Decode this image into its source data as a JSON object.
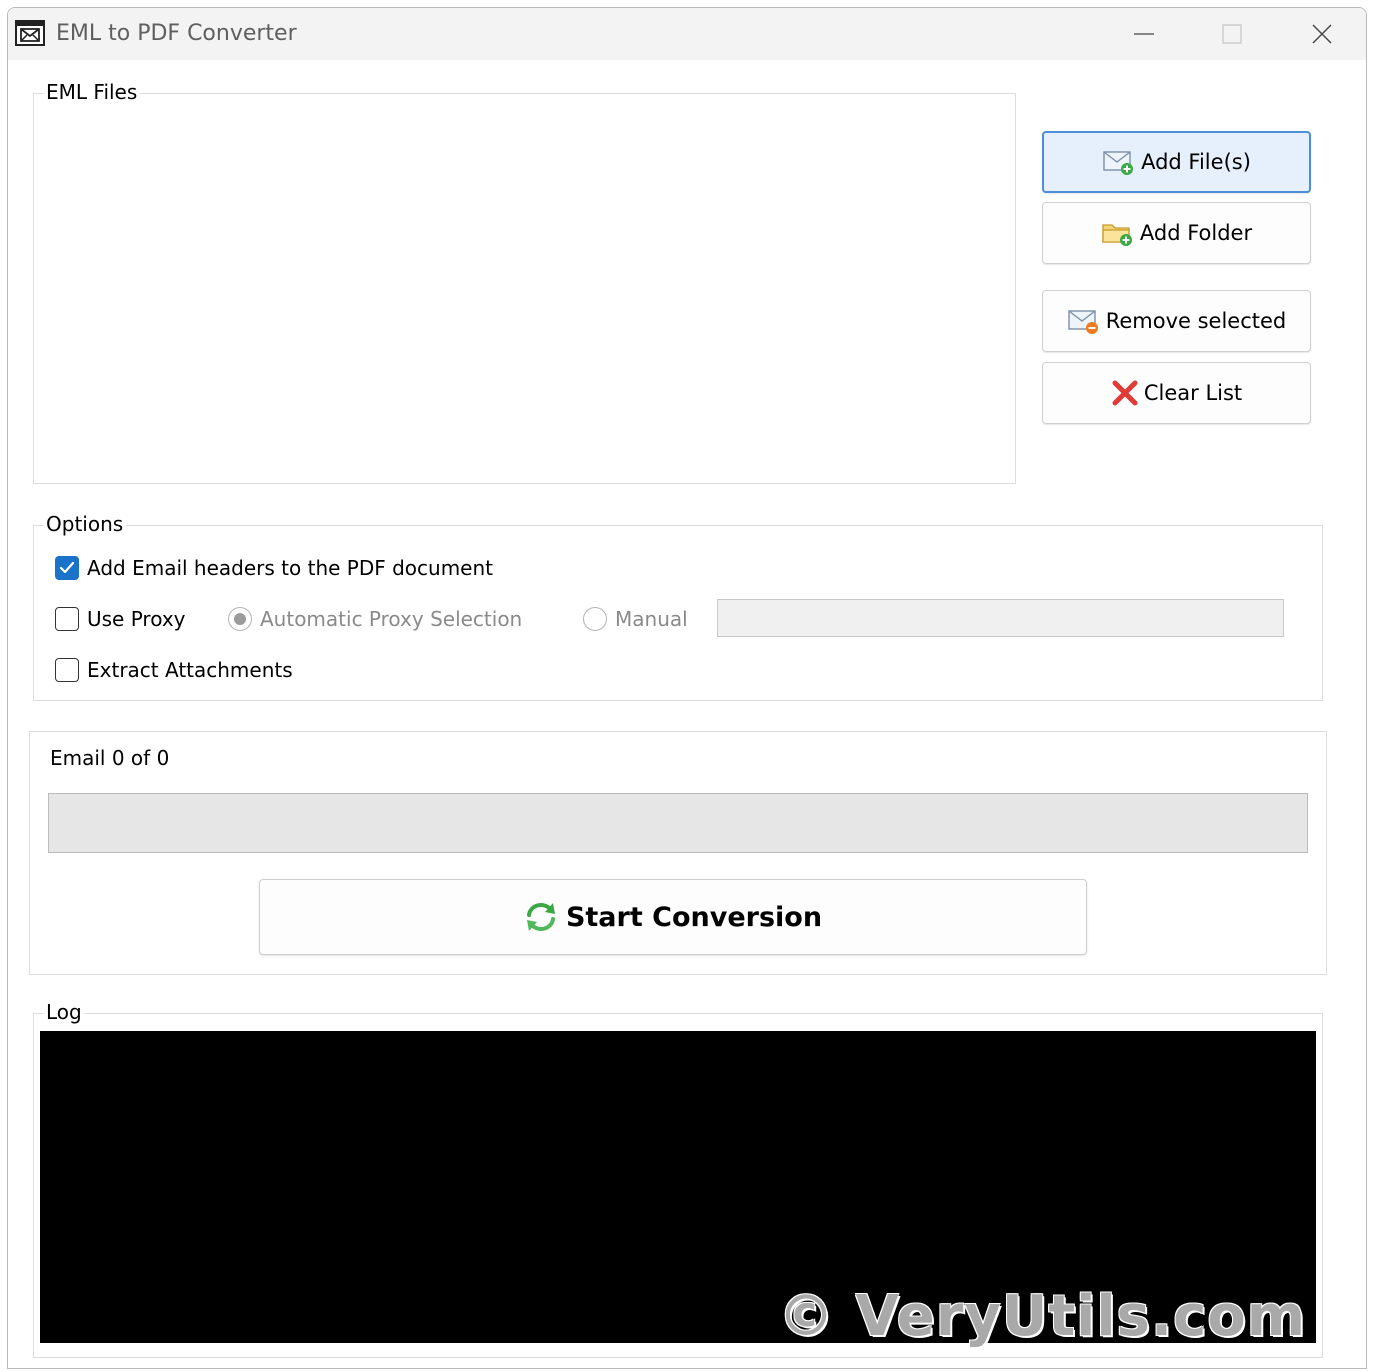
{
  "window": {
    "title": "EML to PDF Converter"
  },
  "icons": {
    "app": "email-window-icon",
    "add_files": "envelope-add-icon",
    "add_folder": "folder-add-icon",
    "remove": "envelope-remove-icon",
    "clear": "red-x-icon",
    "start": "refresh-arrows-icon"
  },
  "files_group": {
    "legend": "EML Files",
    "items": []
  },
  "buttons": {
    "add_files": "Add File(s)",
    "add_folder": "Add Folder",
    "remove_selected": "Remove selected",
    "clear_list": "Clear List",
    "start_conversion": "Start Conversion"
  },
  "options": {
    "legend": "Options",
    "add_headers": {
      "label": "Add Email headers to the PDF document",
      "checked": true
    },
    "use_proxy": {
      "label": "Use Proxy",
      "checked": false
    },
    "automatic_proxy": {
      "label": "Automatic Proxy Selection",
      "selected": true,
      "enabled": false
    },
    "manual_proxy": {
      "label": "Manual",
      "selected": false,
      "enabled": false
    },
    "proxy_address": {
      "value": "",
      "enabled": false
    },
    "extract_attachments": {
      "label": "Extract Attachments",
      "checked": false
    }
  },
  "progress": {
    "label": "Email 0 of 0",
    "fraction": 0
  },
  "log": {
    "legend": "Log",
    "text": ""
  },
  "watermark": "© VeryUtils.com",
  "colors": {
    "accent": "#1a73c9",
    "focus_border": "#4a8fd8",
    "log_background": "#000000",
    "progress_track": "#e6e6e6"
  }
}
